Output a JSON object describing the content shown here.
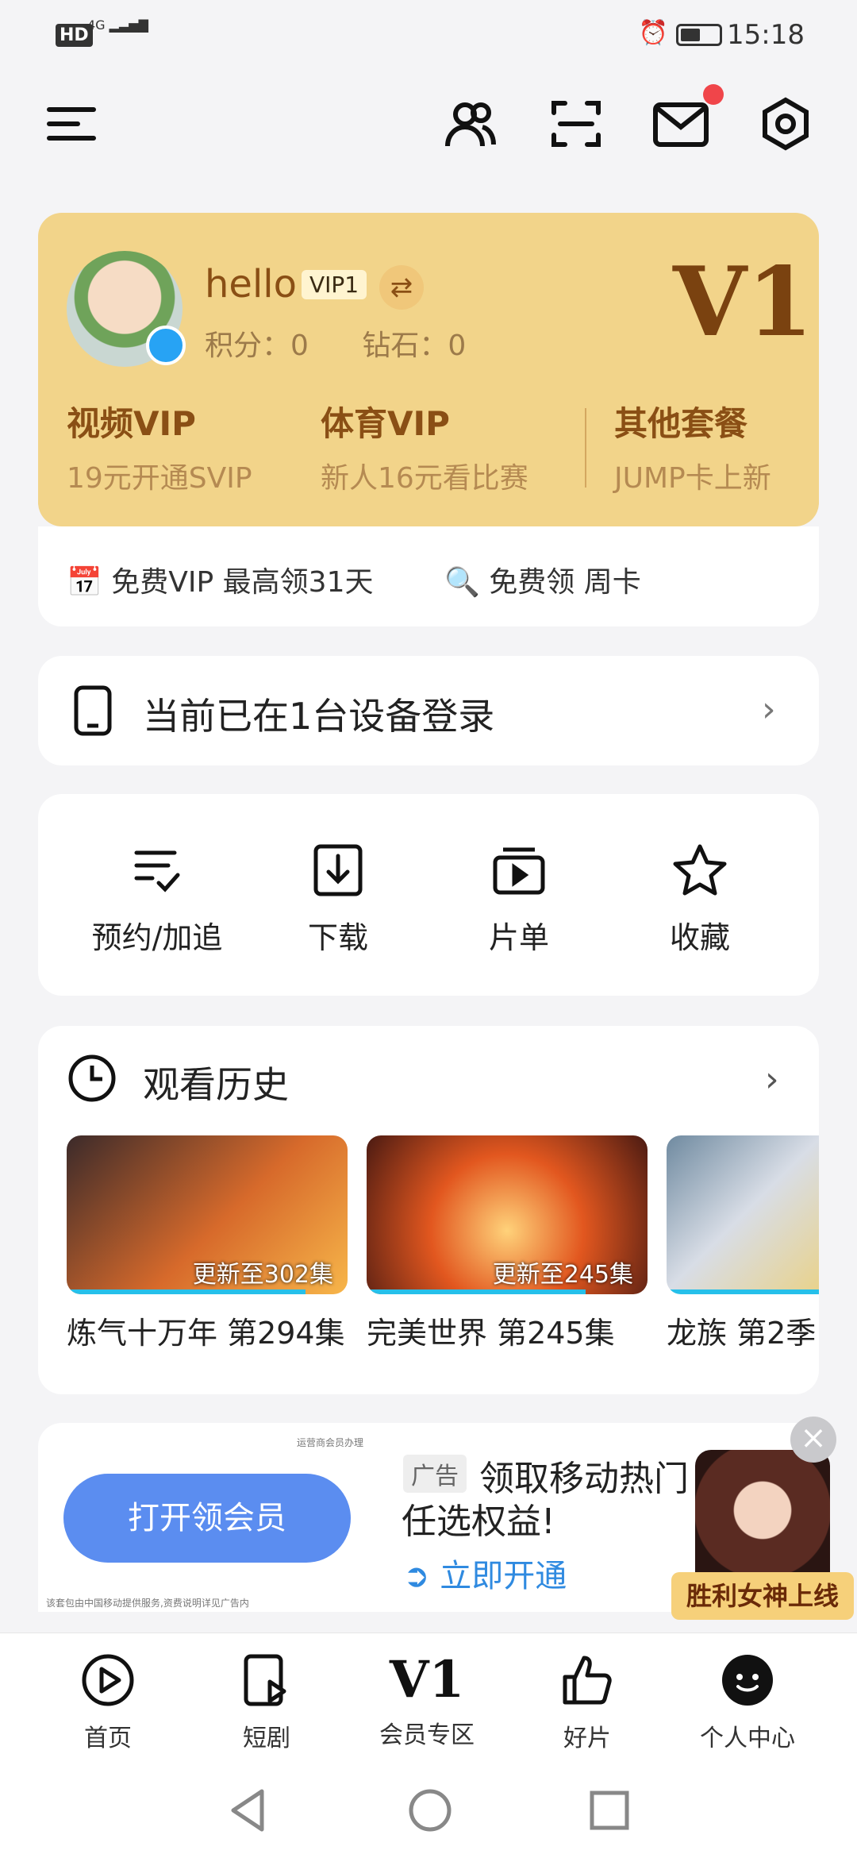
{
  "status_bar": {
    "hd": "HD",
    "signal": "4G",
    "time": "15:18"
  },
  "profile": {
    "username": "hello",
    "vip_badge": "VIP1",
    "points_label": "积分：0",
    "diamonds_label": "钻石：0",
    "level": "V1"
  },
  "vip_options": [
    {
      "title": "视频VIP",
      "subtitle": "19元开通SVIP"
    },
    {
      "title": "体育VIP",
      "subtitle": "新人16元看比赛"
    },
    {
      "title": "其他套餐",
      "subtitle": "JUMP卡上新"
    }
  ],
  "free_offers": {
    "vip": "免费VIP 最高领31天",
    "card": "免费领 周卡"
  },
  "device_login": "当前已在1台设备登录",
  "quick_actions": [
    {
      "label": "预约/加追",
      "icon": "list-check-icon"
    },
    {
      "label": "下载",
      "icon": "download-icon"
    },
    {
      "label": "片单",
      "icon": "playlist-icon"
    },
    {
      "label": "收藏",
      "icon": "star-icon"
    }
  ],
  "history": {
    "title": "观看历史",
    "items": [
      {
        "name": "炼气十万年 第294集",
        "badge": "更新至302集",
        "progress": 0.85
      },
      {
        "name": "完美世界 第245集",
        "badge": "更新至245集",
        "progress": 0.78
      },
      {
        "name": "龙族 第2季",
        "badge": "",
        "progress": 1.0
      }
    ]
  },
  "ad": {
    "button": "打开领会员",
    "tag": "广告",
    "text1": "领取移动热门",
    "text2": "任选权益!",
    "link": "立即开通",
    "banner": "胜利女神上线",
    "close": "×",
    "footnote": "该套包由中国移动提供服务,资费说明详见广告内",
    "operator": "运营商会员办理"
  },
  "bottom_nav": [
    {
      "label": "首页",
      "icon": "play-circle-icon"
    },
    {
      "label": "短剧",
      "icon": "short-drama-icon"
    },
    {
      "label": "会员专区",
      "icon": "v1-icon"
    },
    {
      "label": "好片",
      "icon": "thumbs-up-icon"
    },
    {
      "label": "个人中心",
      "icon": "profile-face-icon"
    }
  ],
  "colors": {
    "accent": "#f2d48a",
    "brand_brown": "#8a4f15",
    "link": "#2f8ae0",
    "ad_button": "#5b8df0"
  }
}
